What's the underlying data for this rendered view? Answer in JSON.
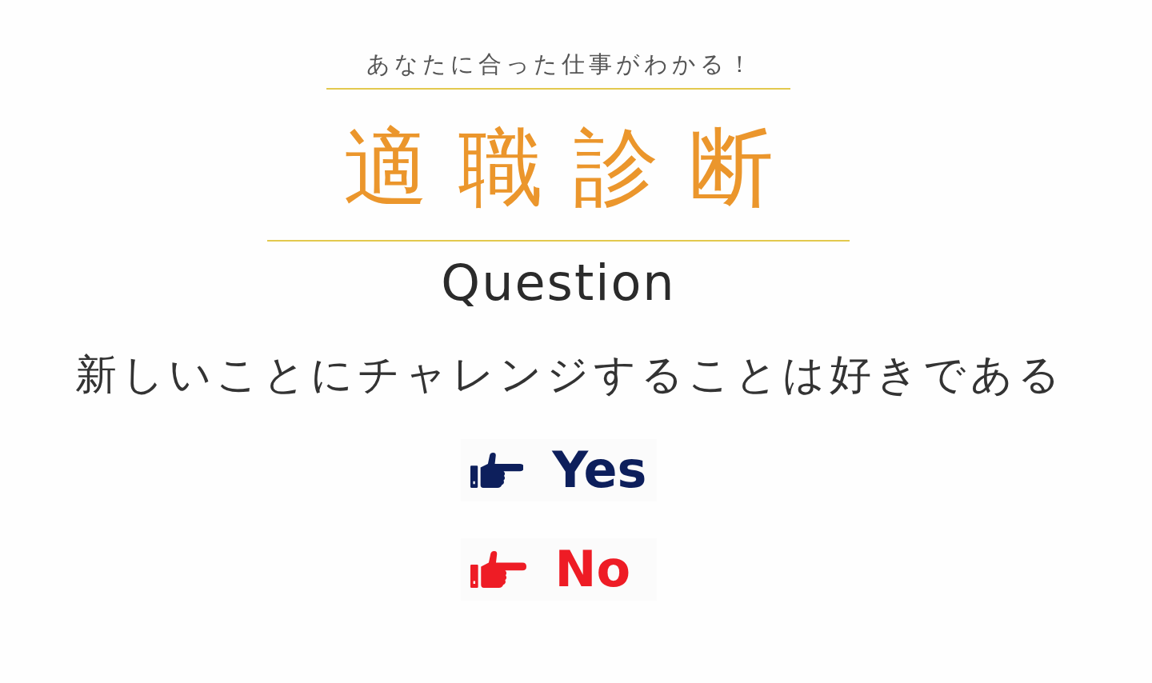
{
  "header": {
    "tagline": "あなたに合った仕事がわかる！",
    "title": "適職診断"
  },
  "question": {
    "label": "Question",
    "text": "新しいことにチャレンジすることは好きである"
  },
  "answers": [
    {
      "label": "Yes",
      "color": "#0d1f5c"
    },
    {
      "label": "No",
      "color": "#ee1c25"
    }
  ]
}
